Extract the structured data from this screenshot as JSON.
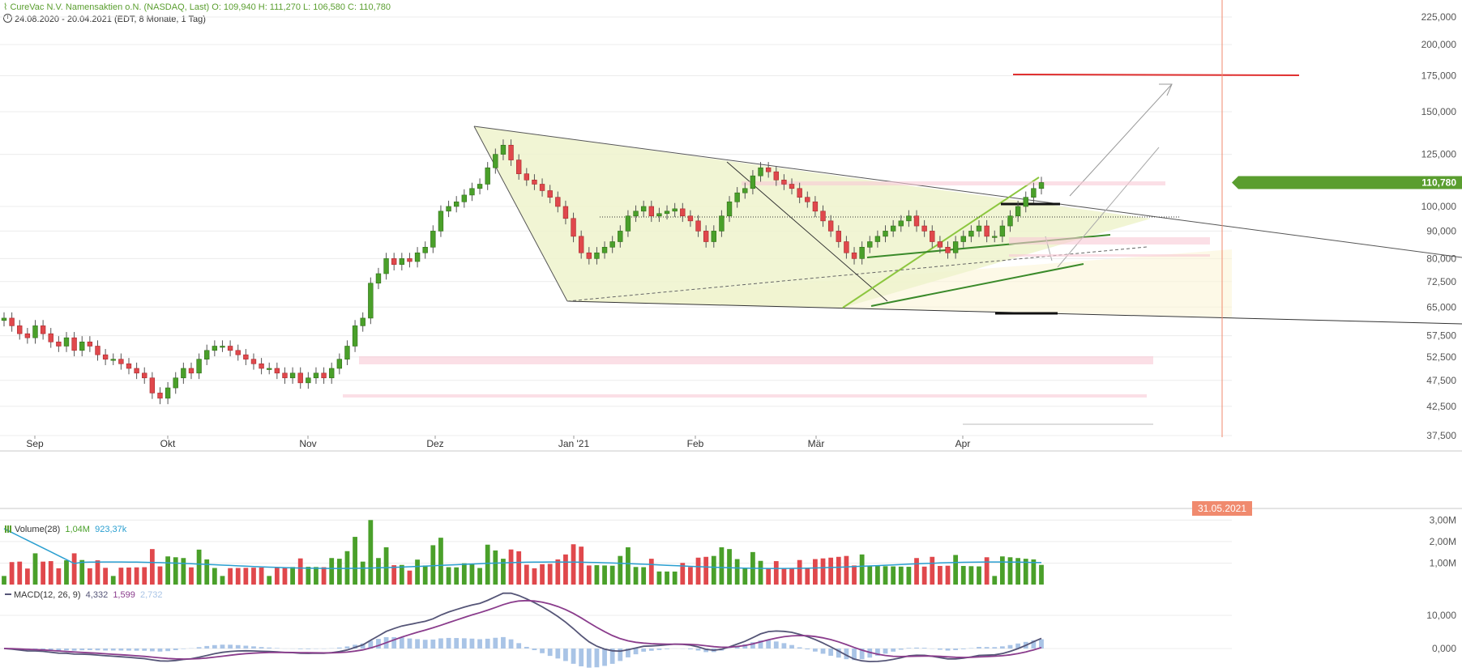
{
  "header": {
    "title": "CureVac N.V. Namensaktien   o.N. (NASDAQ, Last)",
    "ohlc": "O: 109,940   H: 111,270   L: 106,580   C: 110,780",
    "range": "24.08.2020 - 20.04.2021",
    "range_info": "(EDT, 8 Monate, 1 Tag)"
  },
  "price_label": "110,780",
  "date_marker": "31.05.2021",
  "volume_legend": {
    "name": "Volume(28)",
    "v1": "1,04M",
    "v2": "923,37k"
  },
  "macd_legend": {
    "name": "MACD(12, 26, 9)",
    "v1": "4,332",
    "v2": "1,599",
    "v3": "2,732"
  },
  "colors": {
    "up": "#4aa02a",
    "down": "#e0484c",
    "accent_green": "#5a9e2f",
    "marker": "#f08a6e",
    "volume_avg": "#2a9fd0",
    "macd": "#555577",
    "signal": "#8a3c8c",
    "histogram": "#a9c4e6"
  },
  "chart_data": {
    "type": "candlestick",
    "date_range": [
      "2020-08-24",
      "2021-04-20"
    ],
    "month_labels": [
      "Sep",
      "Okt",
      "Nov",
      "Dez",
      "Jan '21",
      "Feb",
      "Mär",
      "Apr"
    ],
    "price_axis": {
      "scale": "log",
      "ticks": [
        "225,000",
        "200,000",
        "175,000",
        "150,000",
        "125,000",
        "100,000",
        "90,000",
        "80,000",
        "72,500",
        "65,000",
        "57,500",
        "52,500",
        "47,500",
        "42,500",
        "37,500"
      ]
    },
    "approx_closes": [
      62,
      60,
      58,
      57,
      60,
      58,
      56,
      55,
      57,
      54,
      56,
      55,
      53,
      52,
      52,
      51,
      50,
      49,
      48,
      45,
      44,
      46,
      48,
      50,
      49,
      52,
      54,
      55,
      55,
      54,
      53,
      52,
      51,
      50,
      50,
      49,
      48,
      49,
      47,
      48,
      49,
      48,
      50,
      52,
      55,
      60,
      62,
      72,
      75,
      80,
      78,
      80,
      79,
      82,
      84,
      90,
      98,
      100,
      102,
      105,
      108,
      110,
      118,
      125,
      130,
      122,
      115,
      112,
      110,
      107,
      104,
      100,
      95,
      88,
      82,
      80,
      82,
      84,
      86,
      90,
      96,
      98,
      100,
      96,
      97,
      98,
      99,
      96,
      94,
      90,
      86,
      90,
      96,
      102,
      106,
      108,
      114,
      118,
      116,
      112,
      110,
      108,
      104,
      102,
      98,
      94,
      90,
      86,
      82,
      80,
      84,
      86,
      88,
      90,
      92,
      94,
      96,
      92,
      90,
      86,
      84,
      82,
      86,
      88,
      90,
      92,
      88,
      88,
      92,
      96,
      100,
      104,
      108,
      110.78
    ],
    "volume_axis": {
      "ticks": [
        "3,00M",
        "2,00M",
        "1,00M"
      ]
    },
    "macd_axis": {
      "ticks": [
        "10,000",
        "0,000"
      ]
    }
  }
}
